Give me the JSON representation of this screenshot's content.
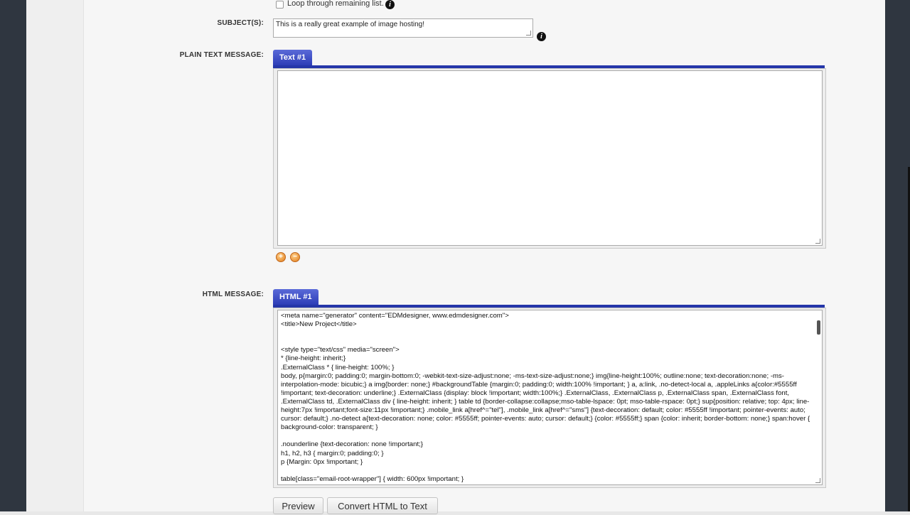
{
  "loop": {
    "label": "Loop through remaining list.",
    "checked": false
  },
  "subject": {
    "label": "SUBJECT(S):",
    "value": "This is a really great example of image hosting!"
  },
  "plain_text": {
    "label": "PLAIN TEXT MESSAGE:",
    "tab_label": "Text #1",
    "value": ""
  },
  "html_message": {
    "label": "HTML MESSAGE:",
    "tab_label": "HTML #1",
    "code": "<meta name=\"generator\" content=\"EDMdesigner, www.edmdesigner.com\">\n<title>New Project</title>\n\n\n<style type=\"text/css\" media=\"screen\">\n* {line-height: inherit;}\n.ExternalClass * { line-height: 100%; }\nbody, p{margin:0; padding:0; margin-bottom:0; -webkit-text-size-adjust:none; -ms-text-size-adjust:none;} img{line-height:100%; outline:none; text-decoration:none; -ms-interpolation-mode: bicubic;} a img{border: none;} #backgroundTable {margin:0; padding:0; width:100% !important; } a, a:link, .no-detect-local a, .appleLinks a{color:#5555ff !important; text-decoration: underline;} .ExternalClass {display: block !important; width:100%;} .ExternalClass, .ExternalClass p, .ExternalClass span, .ExternalClass font, .ExternalClass td, .ExternalClass div { line-height: inherit; } table td {border-collapse:collapse;mso-table-lspace: 0pt; mso-table-rspace: 0pt;} sup{position: relative; top: 4px; line-height:7px !important;font-size:11px !important;} .mobile_link a[href^=\"tel\"], .mobile_link a[href^=\"sms\"] {text-decoration: default; color: #5555ff !important; pointer-events: auto; cursor: default;} .no-detect a{text-decoration: none; color: #5555ff; pointer-events: auto; cursor: default;} {color: #5555ff;} span {color: inherit; border-bottom: none;} span:hover { background-color: transparent; }\n\n.nounderline {text-decoration: none !important;}\nh1, h2, h3 { margin:0; padding:0; }\np {Margin: 0px !important; }\n\ntable[class=\"email-root-wrapper\"] { width: 600px !important; }"
  },
  "buttons": {
    "preview": "Preview",
    "convert": "Convert HTML to Text"
  },
  "icons": {
    "info": "info-icon",
    "add": "add-icon",
    "remove": "remove-icon"
  },
  "colors": {
    "tab_blue": "#2d3db7",
    "sidebar": "#2f3640"
  }
}
